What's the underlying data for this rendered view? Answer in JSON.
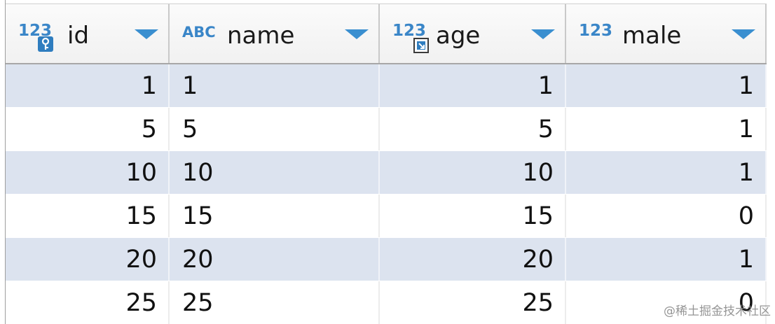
{
  "columns": [
    {
      "type_tag": "123",
      "name": "id",
      "icon": "primary-key-icon",
      "align": "right"
    },
    {
      "type_tag": "ABC",
      "name": "name",
      "icon": "text-type-icon",
      "align": "left"
    },
    {
      "type_tag": "123",
      "name": "age",
      "icon": "index-icon",
      "align": "right"
    },
    {
      "type_tag": "123",
      "name": "male",
      "icon": "numeric-type-icon",
      "align": "right"
    }
  ],
  "rows": [
    [
      "1",
      "1",
      "1",
      "1"
    ],
    [
      "5",
      "5",
      "5",
      "1"
    ],
    [
      "10",
      "10",
      "10",
      "1"
    ],
    [
      "15",
      "15",
      "15",
      "0"
    ],
    [
      "20",
      "20",
      "20",
      "1"
    ],
    [
      "25",
      "25",
      "25",
      "0"
    ]
  ],
  "colors": {
    "type_tag": "#3a86c8",
    "sort_arrow": "#3a8fd0",
    "row_highlight": "#dce3ef"
  },
  "watermark": "@稀土掘金技术社区"
}
